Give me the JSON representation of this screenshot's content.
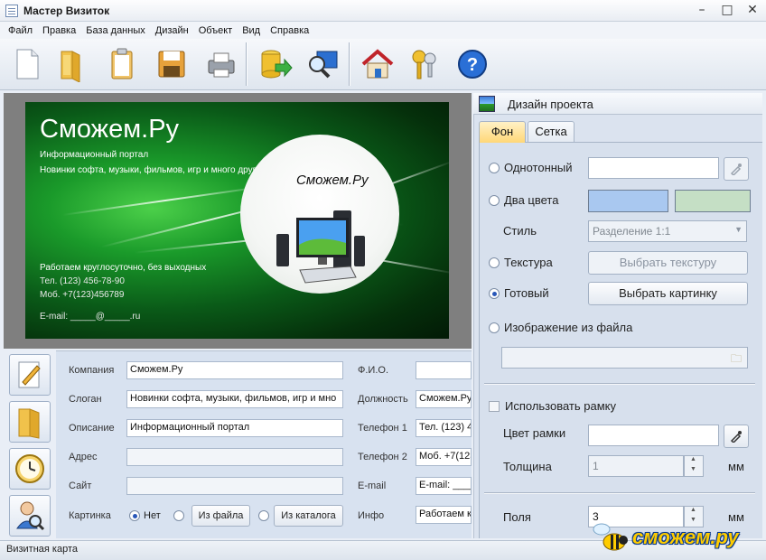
{
  "window": {
    "title": "Мастер Визиток"
  },
  "menu": [
    "Файл",
    "Правка",
    "База данных",
    "Дизайн",
    "Объект",
    "Вид",
    "Справка"
  ],
  "toolbar": {
    "buttons": [
      "new-document-icon",
      "open-folder-icon",
      "clipboard-icon",
      "save-icon",
      "print-icon",
      "database-export-icon",
      "search-preview-icon",
      "home-icon",
      "keys-icon",
      "help-icon"
    ]
  },
  "card": {
    "company": "Сможем.Ру",
    "description": "Информационный портал",
    "slogan": "Новинки софта, музыки, фильмов, игр и много другого",
    "circle_title": "Сможем.Ру",
    "line1": "Работаем круглосуточно, без выходных",
    "line2": "Тел. (123) 456-78-90",
    "line3": "Моб. +7(123)456789",
    "line4": "E-mail: _____@_____.ru"
  },
  "form": {
    "company_label": "Компания",
    "company_value": "Сможем.Ру",
    "slogan_label": "Слоган",
    "slogan_value": "Новинки софта, музыки, фильмов, игр и мно",
    "description_label": "Описание",
    "description_value": "Информационный портал",
    "address_label": "Адрес",
    "address_value": "",
    "site_label": "Сайт",
    "site_value": "",
    "picture_label": "Картинка",
    "picture_options": {
      "none": "Нет",
      "from_file": "Из файла",
      "from_catalog": "Из каталога"
    },
    "fio_label": "Ф.И.О.",
    "fio_value": "",
    "position_label": "Должность",
    "position_value": "Сможем.Ру",
    "phone1_label": "Телефон 1",
    "phone1_value": "Тел. (123) 4",
    "phone2_label": "Телефон 2",
    "phone2_value": "Моб. +7(123",
    "email_label": "E-mail",
    "email_value": "E-mail: _____",
    "info_label": "Инфо",
    "info_value": "Работаем к"
  },
  "design_panel": {
    "title": "Дизайн проекта",
    "tabs": [
      "Фон",
      "Сетка"
    ],
    "solid_label": "Однотонный",
    "two_colors_label": "Два цвета",
    "style_label": "Стиль",
    "style_value": "Разделение 1:1",
    "texture_label": "Текстура",
    "texture_button": "Выбрать текстуру",
    "ready_label": "Готовый",
    "ready_button": "Выбрать картинку",
    "image_file_label": "Изображение из файла",
    "use_frame_label": "Использовать рамку",
    "frame_color_label": "Цвет рамки",
    "thickness_label": "Толщина",
    "thickness_value": "1",
    "thickness_unit": "мм",
    "margins_label": "Поля",
    "margins_value": "3",
    "margins_unit": "мм",
    "colors": {
      "color1": "#a9c8f0",
      "color2": "#c5dfc5"
    }
  },
  "status": {
    "text": "Визитная карта"
  },
  "watermark": {
    "text": "сможем.ру"
  }
}
